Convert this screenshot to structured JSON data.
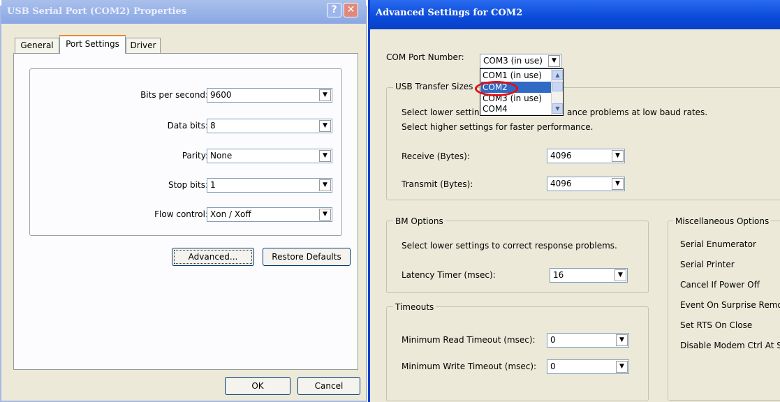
{
  "left_window": {
    "title": "USB Serial Port (COM2) Properties",
    "help_btn": "?",
    "close_btn": "✕",
    "tabs": [
      "General",
      "Port Settings",
      "Driver"
    ],
    "active_tab": "Port Settings",
    "fields": [
      {
        "label": "Bits per second:",
        "value": "9600"
      },
      {
        "label": "Data bits:",
        "value": "8"
      },
      {
        "label": "Parity:",
        "value": "None"
      },
      {
        "label": "Stop bits:",
        "value": "1"
      },
      {
        "label": "Flow control:",
        "value": "Xon / Xoff"
      }
    ],
    "advanced_btn": "Advanced...",
    "restore_btn": "Restore Defaults",
    "ok_btn": "OK",
    "cancel_btn": "Cancel"
  },
  "right_window": {
    "title": "Advanced Settings for COM2",
    "com_port": {
      "label": "COM Port Number:",
      "value": "COM3 (in use)",
      "options": [
        "COM1 (in use)",
        "COM2",
        "COM3 (in use)",
        "COM4"
      ],
      "selected_option": "COM2"
    },
    "usb_transfer": {
      "legend": "USB Transfer Sizes",
      "desc1_a": "Select lower settin",
      "desc1_b": "ance problems at low baud rates.",
      "desc2": "Select higher settings for faster performance.",
      "receive_label": "Receive (Bytes):",
      "receive_value": "4096",
      "transmit_label": "Transmit (Bytes):",
      "transmit_value": "4096"
    },
    "bm_options": {
      "legend": "BM Options",
      "desc": "Select lower settings to correct response problems.",
      "latency_label": "Latency Timer (msec):",
      "latency_value": "16"
    },
    "timeouts": {
      "legend": "Timeouts",
      "min_read_label": "Minimum Read Timeout (msec):",
      "min_read_value": "0",
      "min_write_label": "Minimum Write Timeout (msec):",
      "min_write_value": "0"
    },
    "misc": {
      "legend": "Miscellaneous Options",
      "items": [
        "Serial Enumerator",
        "Serial Printer",
        "Cancel If Power Off",
        "Event On Surprise Remo",
        "Set RTS On Close",
        "Disable Modem Ctrl At S"
      ]
    }
  },
  "colors": {
    "dialog_bg": "#ece9d8",
    "active_title": "#0a4ad8",
    "inactive_title": "#8aa7e3",
    "selection": "#316ac5",
    "highlight_circle": "#e01010"
  },
  "icons": {
    "dropdown": "chevron-down-icon",
    "scroll_up": "chevron-up-icon",
    "scroll_down": "chevron-down-icon"
  }
}
